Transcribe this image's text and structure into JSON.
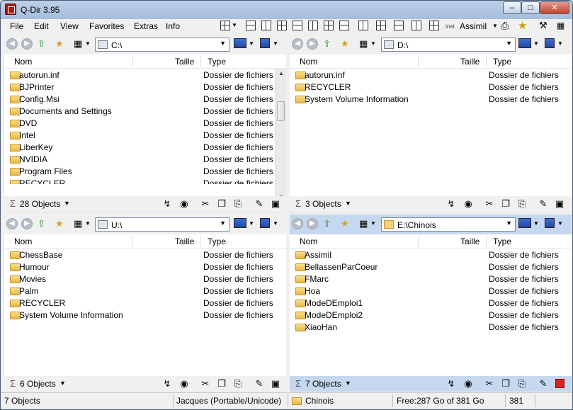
{
  "window": {
    "title": "Q-Dir 3.95"
  },
  "menu": [
    "File",
    "Edit",
    "View",
    "Favorites",
    "Extras",
    "Info"
  ],
  "menu_right": {
    "label": "Assimil",
    "inet": "inet"
  },
  "header": {
    "name": "Nom",
    "size": "Taille",
    "type": "Type"
  },
  "panes": [
    {
      "path": "C:\\",
      "count": "28 Objects",
      "rows": [
        {
          "name": "autorun.inf",
          "type": "Dossier de fichiers"
        },
        {
          "name": "BJPrinter",
          "type": "Dossier de fichiers"
        },
        {
          "name": "Config.Msi",
          "type": "Dossier de fichiers"
        },
        {
          "name": "Documents and Settings",
          "type": "Dossier de fichiers"
        },
        {
          "name": "DVD",
          "type": "Dossier de fichiers"
        },
        {
          "name": "Intel",
          "type": "Dossier de fichiers"
        },
        {
          "name": "LiberKey",
          "type": "Dossier de fichiers"
        },
        {
          "name": "NVIDIA",
          "type": "Dossier de fichiers"
        },
        {
          "name": "Program Files",
          "type": "Dossier de fichiers"
        },
        {
          "name": "RECYCLER",
          "type": "Dossier de fichiers"
        }
      ]
    },
    {
      "path": "D:\\",
      "count": "3 Objects",
      "rows": [
        {
          "name": "autorun.inf",
          "type": "Dossier de fichiers"
        },
        {
          "name": "RECYCLER",
          "type": "Dossier de fichiers"
        },
        {
          "name": "System Volume Information",
          "type": "Dossier de fichiers"
        }
      ]
    },
    {
      "path": "U:\\",
      "count": "6 Objects",
      "rows": [
        {
          "name": "ChessBase",
          "type": "Dossier de fichiers"
        },
        {
          "name": "Humour",
          "type": "Dossier de fichiers"
        },
        {
          "name": "Movies",
          "type": "Dossier de fichiers"
        },
        {
          "name": "Palm",
          "type": "Dossier de fichiers"
        },
        {
          "name": "RECYCLER",
          "type": "Dossier de fichiers"
        },
        {
          "name": "System Volume Information",
          "type": "Dossier de fichiers"
        }
      ]
    },
    {
      "path": "E:\\Chinois",
      "count": "7 Objects",
      "rows": [
        {
          "name": "Assimil",
          "type": "Dossier de fichiers"
        },
        {
          "name": "BellassenParCoeur",
          "type": "Dossier de fichiers"
        },
        {
          "name": "FMarc",
          "type": "Dossier de fichiers"
        },
        {
          "name": "Hoa",
          "type": "Dossier de fichiers"
        },
        {
          "name": "ModeDEmploi1",
          "type": "Dossier de fichiers"
        },
        {
          "name": "ModeDEmploi2",
          "type": "Dossier de fichiers"
        },
        {
          "name": "XiaoHan",
          "type": "Dossier de fichiers"
        }
      ]
    }
  ],
  "statusbar": {
    "objects": "7 Objects",
    "user": "Jacques (Portable/Unicode)",
    "folder": "Chinois",
    "free": "Free:287 Go of 381 Go",
    "num": "381"
  },
  "colors": {
    "active_pane": "#c6d8ef",
    "folder": "#e5b94a"
  }
}
